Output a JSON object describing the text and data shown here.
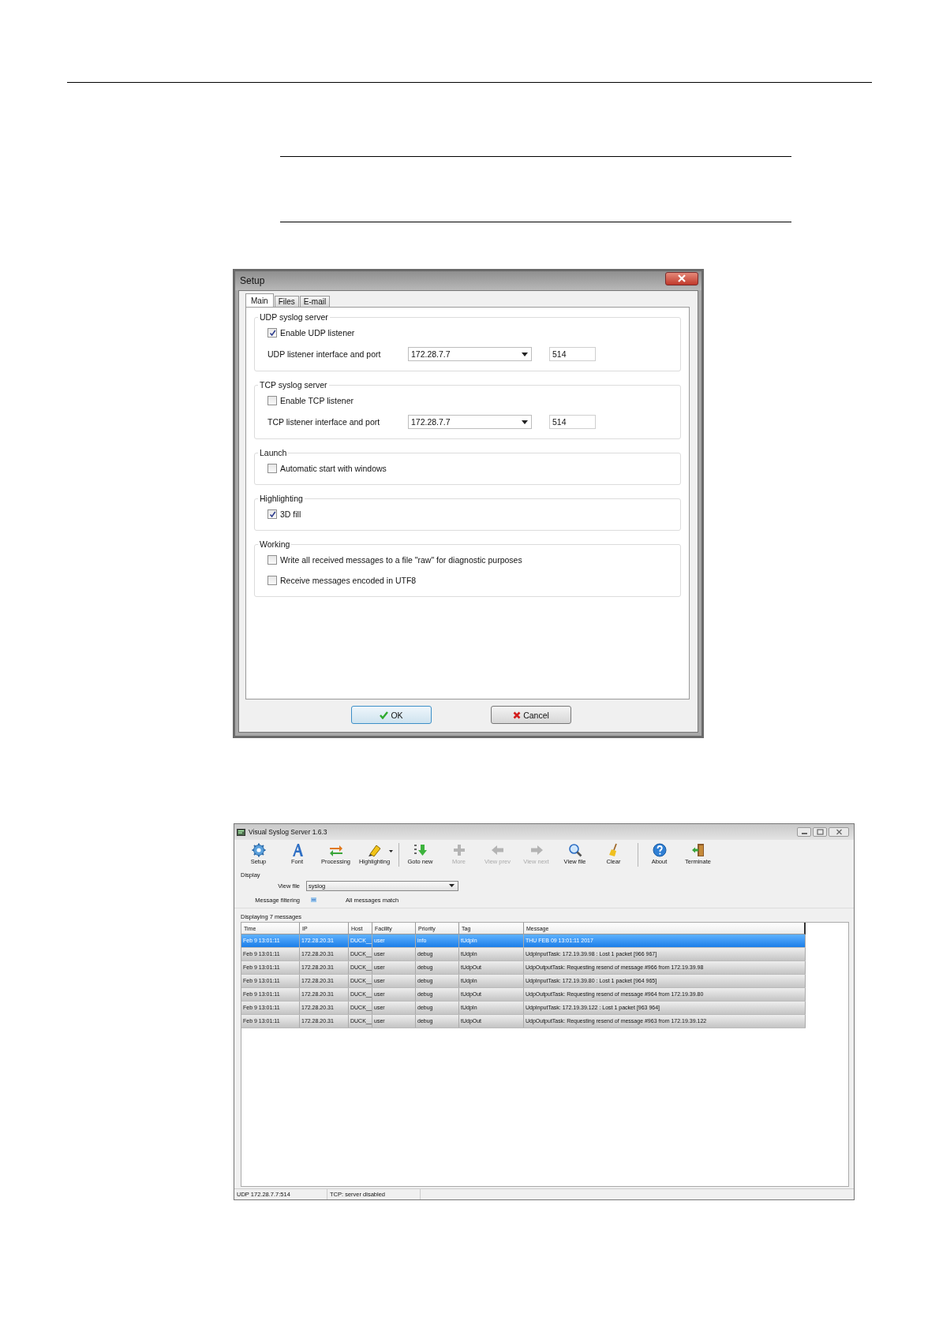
{
  "setup_dialog": {
    "title": "Setup",
    "tabs": [
      {
        "label": "Main",
        "selected": true
      },
      {
        "label": "Files",
        "selected": false
      },
      {
        "label": "E-mail",
        "selected": false
      }
    ],
    "groups": [
      {
        "title": "UDP syslog server",
        "items": [
          {
            "kind": "checkbox",
            "label": "Enable UDP listener",
            "checked": true
          },
          {
            "kind": "interface",
            "label": "UDP listener interface and port",
            "address": "172.28.7.7",
            "port": "514"
          }
        ]
      },
      {
        "title": "TCP syslog server",
        "items": [
          {
            "kind": "checkbox",
            "label": "Enable TCP listener",
            "checked": false
          },
          {
            "kind": "interface",
            "label": "TCP listener interface and port",
            "address": "172.28.7.7",
            "port": "514"
          }
        ]
      },
      {
        "title": "Launch",
        "items": [
          {
            "kind": "checkbox",
            "label": "Automatic start with windows",
            "checked": false
          }
        ]
      },
      {
        "title": "Highlighting",
        "items": [
          {
            "kind": "checkbox",
            "label": "3D fill",
            "checked": true
          }
        ]
      },
      {
        "title": "Working",
        "items": [
          {
            "kind": "checkbox",
            "label": "Write all received messages to a file \"raw\" for diagnostic purposes",
            "checked": false
          },
          {
            "kind": "checkbox",
            "label": "Receive messages encoded in UTF8",
            "checked": false
          }
        ]
      }
    ],
    "buttons": [
      {
        "kind": "ok",
        "label": "OK",
        "focused": true
      },
      {
        "kind": "cancel",
        "label": "Cancel",
        "focused": false
      }
    ]
  },
  "syslog_window": {
    "title": "Visual Syslog Server 1.6.3",
    "toolbar": [
      {
        "buttons": [
          {
            "kind": "setup",
            "label": "Setup",
            "disabled": false,
            "dropdown": false
          },
          {
            "kind": "font",
            "label": "Font",
            "disabled": false,
            "dropdown": false
          },
          {
            "kind": "processing",
            "label": "Processing",
            "disabled": false,
            "dropdown": false
          },
          {
            "kind": "highlighting",
            "label": "Highlighting",
            "disabled": false,
            "dropdown": true
          }
        ]
      },
      {
        "buttons": [
          {
            "kind": "goto",
            "label": "Goto new",
            "disabled": false,
            "dropdown": false
          },
          {
            "kind": "more",
            "label": "More",
            "disabled": true,
            "dropdown": false
          },
          {
            "kind": "prev",
            "label": "View prev",
            "disabled": true,
            "dropdown": false
          },
          {
            "kind": "next",
            "label": "View next",
            "disabled": true,
            "dropdown": false
          },
          {
            "kind": "view",
            "label": "View file",
            "disabled": false,
            "dropdown": false
          },
          {
            "kind": "clear",
            "label": "Clear",
            "disabled": false,
            "dropdown": false
          }
        ]
      },
      {
        "buttons": [
          {
            "kind": "about",
            "label": "About",
            "disabled": false,
            "dropdown": false
          },
          {
            "kind": "terminate",
            "label": "Terminate",
            "disabled": false,
            "dropdown": false
          }
        ]
      }
    ],
    "display": {
      "title": "Display",
      "view_file_label": "View file",
      "view_file": "syslog",
      "filter_label": "Message filtering",
      "filter_status": "All messages match"
    },
    "count": "Displaying 7 messages",
    "columns": [
      "Time",
      "IP",
      "Host",
      "Facility",
      "Priority",
      "Tag",
      "Message"
    ],
    "rows": [
      {
        "selected": true,
        "cells": [
          "Feb  9 13:01:11",
          "172.28.20.31",
          "DUCK__",
          "user",
          "info",
          "tUdpIn",
          "THU FEB 09 13:01:11 2017"
        ]
      },
      {
        "selected": false,
        "cells": [
          "Feb  9 13:01:11",
          "172.28.20.31",
          "DUCK__",
          "user",
          "debug",
          "tUdpIn",
          "UdpInputTask: 172.19.39.98 : Lost 1 packet [966 967]"
        ]
      },
      {
        "selected": false,
        "cells": [
          "Feb  9 13:01:11",
          "172.28.20.31",
          "DUCK__",
          "user",
          "debug",
          "tUdpOut",
          "UdpOutputTask: Requesting resend of message #966 from 172.19.39.98"
        ]
      },
      {
        "selected": false,
        "cells": [
          "Feb  9 13:01:11",
          "172.28.20.31",
          "DUCK__",
          "user",
          "debug",
          "tUdpIn",
          "UdpInputTask: 172.19.39.80 : Lost 1 packet [964 965]"
        ]
      },
      {
        "selected": false,
        "cells": [
          "Feb  9 13:01:11",
          "172.28.20.31",
          "DUCK__",
          "user",
          "debug",
          "tUdpOut",
          "UdpOutputTask: Requesting resend of message #964 from 172.19.39.80"
        ]
      },
      {
        "selected": false,
        "cells": [
          "Feb  9 13:01:11",
          "172.28.20.31",
          "DUCK__",
          "user",
          "debug",
          "tUdpIn",
          "UdpInputTask: 172.19.39.122 : Lost 1 packet [963 964]"
        ]
      },
      {
        "selected": false,
        "cells": [
          "Feb  9 13:01:11",
          "172.28.20.31",
          "DUCK__",
          "user",
          "debug",
          "tUdpOut",
          "UdpOutputTask: Requesting resend of message #963 from 172.19.39.122"
        ]
      }
    ],
    "status_bar": [
      "UDP 172.28.7.7:514",
      "TCP: server disabled"
    ]
  }
}
